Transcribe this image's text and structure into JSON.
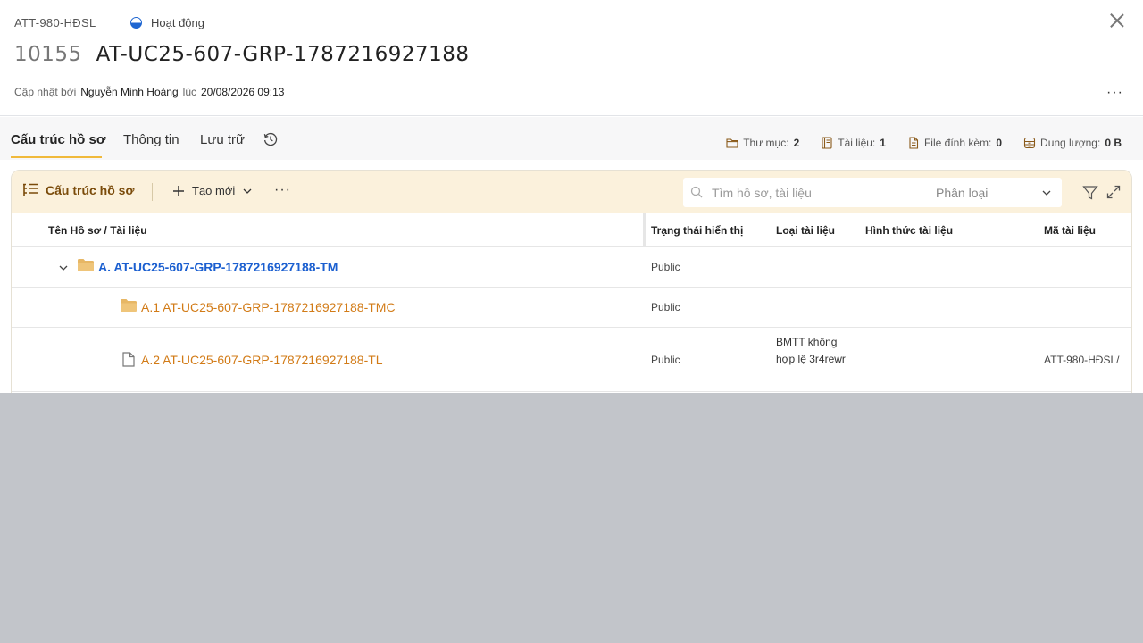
{
  "header": {
    "code": "ATT-980-HĐSL",
    "status": "Hoạt động",
    "title_number": "10155",
    "title": "AT-UC25-607-GRP-1787216927188",
    "updated_by_label": "Cập nhật bởi",
    "updated_by": "Nguyễn Minh Hoàng",
    "at_label": "lúc",
    "updated_at": "20/08/2026 09:13",
    "more": "···"
  },
  "tabs": [
    {
      "label": "Cấu trúc hồ sơ",
      "active": true
    },
    {
      "label": "Thông tin",
      "active": false
    },
    {
      "label": "Lưu trữ",
      "active": false
    }
  ],
  "stats": [
    {
      "icon": "folder-outline-icon",
      "label": "Thư mục:",
      "value": "2"
    },
    {
      "icon": "book-icon",
      "label": "Tài liệu:",
      "value": "1"
    },
    {
      "icon": "file-icon",
      "label": "File đính kèm:",
      "value": "0"
    },
    {
      "icon": "storage-icon",
      "label": "Dung lượng:",
      "value": "0 B"
    }
  ],
  "toolbar": {
    "title": "Cấu trúc hồ sơ",
    "new_label": "Tạo mới",
    "more": "···",
    "search_placeholder": "Tìm hồ sơ, tài liệu",
    "classify_placeholder": "Phân loại"
  },
  "table": {
    "columns": [
      "Tên Hồ sơ / Tài liệu",
      "Trạng thái hiển thị",
      "Loại tài liệu",
      "Hình thức tài liệu",
      "Mã tài liệu"
    ],
    "rows": [
      {
        "name": "A. AT-UC25-607-GRP-1787216927188-TM",
        "status": "Public",
        "type": "",
        "form": "",
        "code": "",
        "kind": "folder",
        "level": 0,
        "expanded": true
      },
      {
        "name": "A.1 AT-UC25-607-GRP-1787216927188-TMC",
        "status": "Public",
        "type": "",
        "form": "",
        "code": "",
        "kind": "folder",
        "level": 1
      },
      {
        "name": "A.2 AT-UC25-607-GRP-1787216927188-TL",
        "status": "Public",
        "type": "BMTT không hợp lệ 3r4rewr",
        "form": "",
        "code": "ATT-980-HĐSL/",
        "kind": "document",
        "level": 1
      }
    ]
  },
  "colors": {
    "accent": "#f0b93b",
    "toolbar_bg": "#fbf1dc",
    "link_blue": "#1b5fd0",
    "link_orange": "#d27b17",
    "overlay": "#c2c5ca"
  }
}
